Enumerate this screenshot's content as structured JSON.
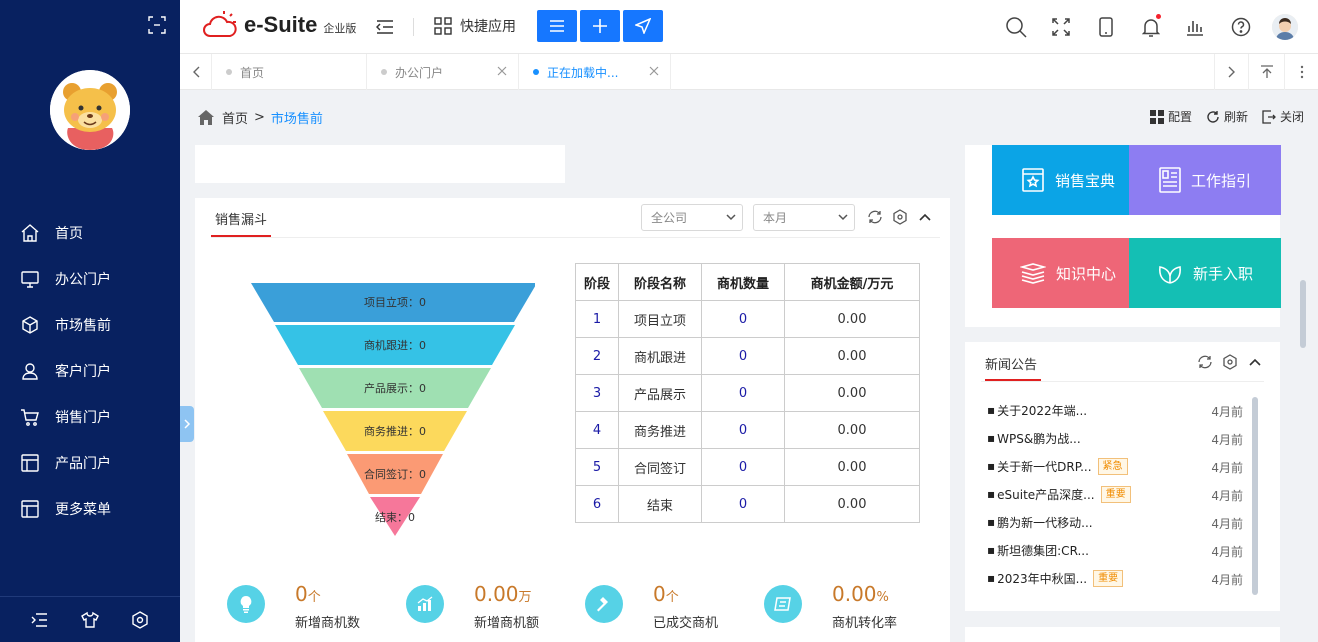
{
  "sidebar": {
    "items": [
      {
        "label": "首页",
        "icon": "home-icon"
      },
      {
        "label": "办公门户",
        "icon": "monitor-icon"
      },
      {
        "label": "市场售前",
        "icon": "box-icon"
      },
      {
        "label": "客户门户",
        "icon": "user-icon"
      },
      {
        "label": "销售门户",
        "icon": "cart-icon"
      },
      {
        "label": "产品门户",
        "icon": "layout-icon"
      },
      {
        "label": "更多菜单",
        "icon": "layout-icon"
      }
    ]
  },
  "header": {
    "logo_text": "e-Suite",
    "logo_sub": "企业版",
    "quick_label": "快捷应用"
  },
  "tabs": [
    {
      "label": "首页",
      "active": false
    },
    {
      "label": "办公门户",
      "active": false
    },
    {
      "label": "正在加载中...",
      "active": true
    }
  ],
  "breadcrumb": {
    "home": "首页",
    "sep": ">",
    "current": "市场售前"
  },
  "page_actions": {
    "config": "配置",
    "refresh": "刷新",
    "close": "关闭"
  },
  "funnel": {
    "title": "销售漏斗",
    "company_select": "全公司",
    "period_select": "本月",
    "stages": [
      {
        "label": "项目立项：0",
        "color": "#3a9fd9"
      },
      {
        "label": "商机跟进：0",
        "color": "#35c2e6"
      },
      {
        "label": "产品展示：0",
        "color": "#9fe0b2"
      },
      {
        "label": "商务推进：0",
        "color": "#fcd95c"
      },
      {
        "label": "合同签订：0",
        "color": "#fb9a74"
      },
      {
        "label": "结束：0",
        "color": "#f6779a"
      }
    ]
  },
  "stage_table": {
    "headers": [
      "阶段",
      "阶段名称",
      "商机数量",
      "商机金额/万元"
    ],
    "rows": [
      [
        "1",
        "项目立项",
        "0",
        "0.00"
      ],
      [
        "2",
        "商机跟进",
        "0",
        "0.00"
      ],
      [
        "3",
        "产品展示",
        "0",
        "0.00"
      ],
      [
        "4",
        "商务推进",
        "0",
        "0.00"
      ],
      [
        "5",
        "合同签订",
        "0",
        "0.00"
      ],
      [
        "6",
        "结束",
        "0",
        "0.00"
      ]
    ]
  },
  "stats": [
    {
      "value": "0",
      "unit": "个",
      "label": "新增商机数",
      "icon": "bulb-icon"
    },
    {
      "value": "0.00",
      "unit": "万",
      "label": "新增商机额",
      "icon": "chart-icon"
    },
    {
      "value": "0",
      "unit": "个",
      "label": "已成交商机",
      "icon": "hammer-icon"
    },
    {
      "value": "0.00",
      "unit": "%",
      "label": "商机转化率",
      "icon": "scroll-icon"
    }
  ],
  "tiles": [
    {
      "label": "销售宝典",
      "color": "#0ba4e6",
      "icon": "book-star-icon"
    },
    {
      "label": "工作指引",
      "color": "#8d7df2",
      "icon": "document-icon"
    },
    {
      "label": "知识中心",
      "color": "#ee6677",
      "icon": "stack-icon"
    },
    {
      "label": "新手入职",
      "color": "#14bfb4",
      "icon": "leaf-icon"
    }
  ],
  "news": {
    "title": "新闻公告",
    "items": [
      {
        "title": "关于2022年端...",
        "badge": "",
        "date": "4月前"
      },
      {
        "title": "WPS&鹏为战...",
        "badge": "",
        "date": "4月前"
      },
      {
        "title": "关于新一代DRP...",
        "badge": "紧急",
        "date": "4月前"
      },
      {
        "title": "eSuite产品深度...",
        "badge": "重要",
        "date": "4月前"
      },
      {
        "title": "鹏为新一代移动...",
        "badge": "",
        "date": "4月前"
      },
      {
        "title": "斯坦德集团:CR...",
        "badge": "",
        "date": "4月前"
      },
      {
        "title": "2023年中秋国...",
        "badge": "重要",
        "date": "4月前"
      }
    ]
  }
}
